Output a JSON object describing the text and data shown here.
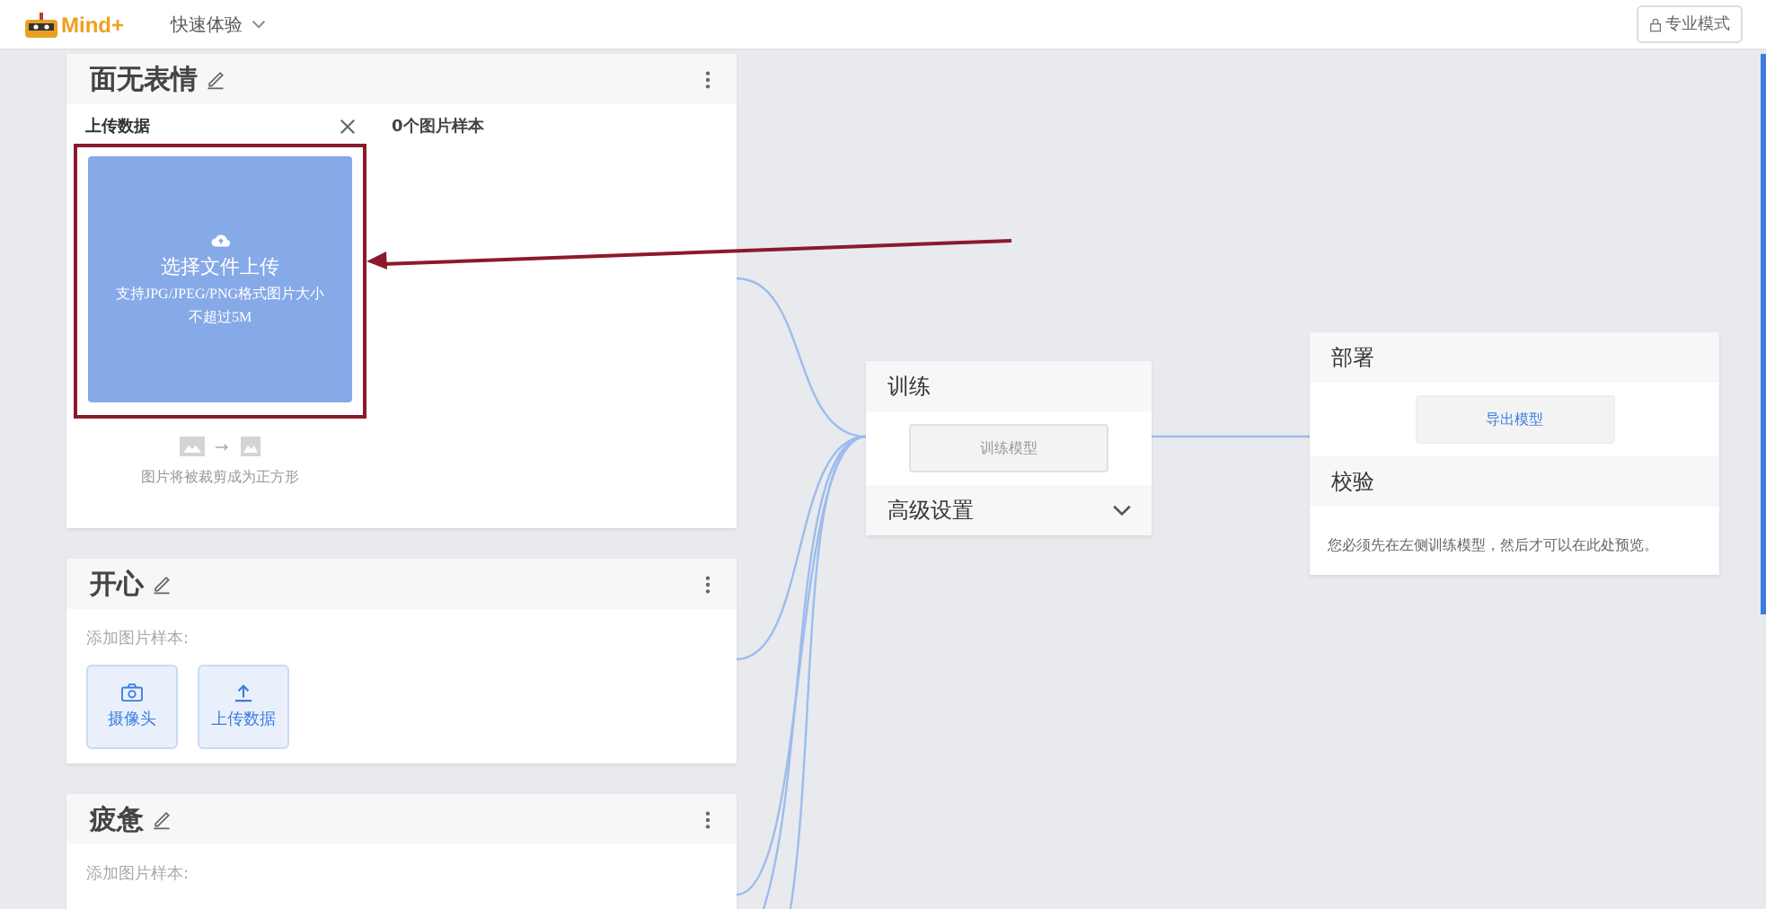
{
  "header": {
    "logo": "Mind+",
    "menu": "快速体验",
    "mode_button": "专业模式"
  },
  "classes": [
    {
      "name": "面无表情",
      "kind": "upload",
      "upload_title": "上传数据",
      "sample_count": "0个图片样本",
      "upload_main": "选择文件上传",
      "upload_hint": [
        "支持JPG/JPEG/PNG格式图片大小",
        "不超过5M"
      ],
      "crop_note": "图片将被裁剪成为正方形"
    },
    {
      "name": "开心",
      "kind": "samples",
      "prompt": "添加图片样本:",
      "buttons": [
        {
          "kind": "camera",
          "label": "摄像头"
        },
        {
          "kind": "upload",
          "label": "上传数据"
        }
      ]
    },
    {
      "name": "疲惫",
      "kind": "samples",
      "prompt": "添加图片样本:"
    }
  ],
  "train": {
    "title": "训练",
    "button": "训练模型",
    "advanced": "高级设置",
    "expanded": false
  },
  "deploy": {
    "title": "部署",
    "export": "导出模型",
    "preview_title": "校验",
    "preview_note": "您必须先在左侧训练模型，然后才可以在此处预览。"
  }
}
